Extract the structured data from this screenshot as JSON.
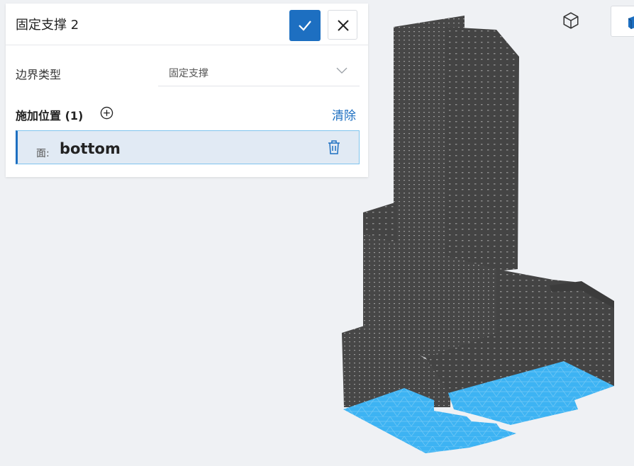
{
  "panel": {
    "title": "固定支撑 2",
    "boundary_type_label": "边界类型",
    "boundary_type_value": "固定支撑",
    "location_label": "施加位置 (1)",
    "clear_label": "清除",
    "faces": [
      {
        "prefix": "面:",
        "name": "bottom"
      }
    ]
  },
  "icons": {
    "confirm": "check-icon",
    "close": "close-icon",
    "dropdown": "chevron-down-icon",
    "add": "plus-circle-icon",
    "delete": "trash-icon",
    "cube": "cube-icon",
    "view": "view-cube-icon"
  },
  "colors": {
    "accent": "#1d6fc1",
    "selected_face": "#3db3f3",
    "mesh": "#474747",
    "selection_bg": "#e1eaf4"
  }
}
